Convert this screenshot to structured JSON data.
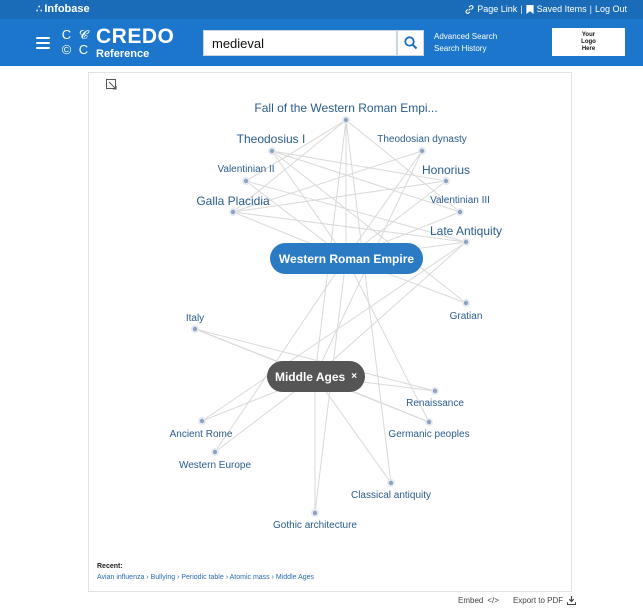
{
  "topbar": {
    "brand": "Infobase",
    "links": [
      "Page Link",
      "Saved Items",
      "Log Out"
    ]
  },
  "header": {
    "logo_main": "CREDO",
    "logo_sub": "Reference",
    "search_value": "medieval",
    "advanced_search": "Advanced Search",
    "search_history": "Search History",
    "your_logo": [
      "Your",
      "Logo",
      "Here"
    ]
  },
  "graph": {
    "hub_primary": "Western Roman Empire",
    "hub_secondary": "Middle Ages",
    "hub_secondary_close": "×",
    "nodes": [
      {
        "id": "fall",
        "label": "Fall of the Western Roman Empi..."
      },
      {
        "id": "theodosius",
        "label": "Theodosius I"
      },
      {
        "id": "theodosian",
        "label": "Theodosian dynasty"
      },
      {
        "id": "valentinian2",
        "label": "Valentinian II"
      },
      {
        "id": "honorius",
        "label": "Honorius"
      },
      {
        "id": "galla",
        "label": "Galla Placidia"
      },
      {
        "id": "valentinian3",
        "label": "Valentinian III"
      },
      {
        "id": "late",
        "label": "Late Antiquity"
      },
      {
        "id": "gratian",
        "label": "Gratian"
      },
      {
        "id": "italy",
        "label": "Italy"
      },
      {
        "id": "renaissance",
        "label": "Renaissance"
      },
      {
        "id": "ancientrome",
        "label": "Ancient Rome"
      },
      {
        "id": "germanic",
        "label": "Germanic peoples"
      },
      {
        "id": "westerneurope",
        "label": "Western Europe"
      },
      {
        "id": "classical",
        "label": "Classical antiquity"
      },
      {
        "id": "gothic",
        "label": "Gothic architecture"
      }
    ]
  },
  "recent": {
    "title": "Recent:",
    "items": [
      "Avian influenza",
      "Bullying",
      "Periodic table",
      "Atomic mass",
      "Middle Ages"
    ]
  },
  "footer": {
    "embed": "Embed",
    "export": "Export to PDF"
  }
}
